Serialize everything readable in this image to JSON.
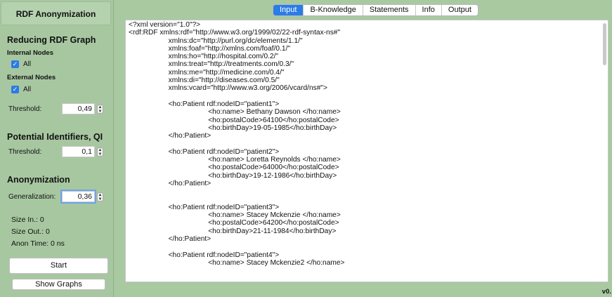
{
  "app": {
    "title": "RDF Anonymization",
    "version": "v0."
  },
  "left": {
    "reducing": {
      "heading": "Reducing RDF Graph",
      "internal_label": "Internal Nodes",
      "internal_all": "All",
      "external_label": "External Nodes",
      "external_all": "All",
      "threshold_label": "Threshold:",
      "threshold_value": "0,49"
    },
    "qi": {
      "heading": "Potential Identifiers, QI",
      "threshold_label": "Threshold:",
      "threshold_value": "0,1"
    },
    "anon": {
      "heading": "Anonymization",
      "generalization_label": "Generalization:",
      "generalization_value": "0,36"
    },
    "stats": {
      "size_in": "Size In.: 0",
      "size_out": "Size Out.: 0",
      "anon_time": "Anon Time: 0 ns"
    },
    "buttons": {
      "start": "Start",
      "show_graphs": "Show Graphs"
    }
  },
  "tabs": [
    {
      "label": "Input",
      "active": true
    },
    {
      "label": "B-Knowledge",
      "active": false
    },
    {
      "label": "Statements",
      "active": false
    },
    {
      "label": "Info",
      "active": false
    },
    {
      "label": "Output",
      "active": false
    }
  ],
  "editor": {
    "lines": [
      "<?xml version=\"1.0\"?>",
      "<rdf:RDF xmlns:rdf=\"http://www.w3.org/1999/02/22-rdf-syntax-ns#\"",
      "                    xmlns:dc=\"http://purl.org/dc/elements/1.1/\"",
      "                    xmlns:foaf=\"http://xmlns.com/foaf/0.1/\"",
      "                    xmlns:ho=\"http://hospital.com/0.2/\"",
      "                    xmlns:treat=\"http://treatments.com/0.3/\"",
      "                    xmlns:me=\"http://medicine.com/0.4/\"",
      "                    xmlns:di=\"http://diseases.com/0.5/\"",
      "                    xmlns:vcard=\"http://www.w3.org/2006/vcard/ns#\">",
      "",
      "                    <ho:Patient rdf:nodeID=\"patient1\">",
      "                                        <ho:name> Bethany Dawson </ho:name>",
      "                                        <ho:postalCode>64100</ho:postalCode>",
      "                                        <ho:birthDay>19-05-1985</ho:birthDay>",
      "                    </ho:Patient>",
      "",
      "                    <ho:Patient rdf:nodeID=\"patient2\">",
      "                                        <ho:name> Loretta Reynolds </ho:name>",
      "                                        <ho:postalCode>64000</ho:postalCode>",
      "                                        <ho:birthDay>19-12-1986</ho:birthDay>",
      "                    </ho:Patient>",
      "",
      "",
      "                    <ho:Patient rdf:nodeID=\"patient3\">",
      "                                        <ho:name> Stacey Mckenzie </ho:name>",
      "                                        <ho:postalCode>64200</ho:postalCode>",
      "                                        <ho:birthDay>21-11-1984</ho:birthDay>",
      "                    </ho:Patient>",
      "",
      "                    <ho:Patient rdf:nodeID=\"patient4\">",
      "                                        <ho:name> Stacey Mckenzie2 </ho:name>"
    ]
  }
}
